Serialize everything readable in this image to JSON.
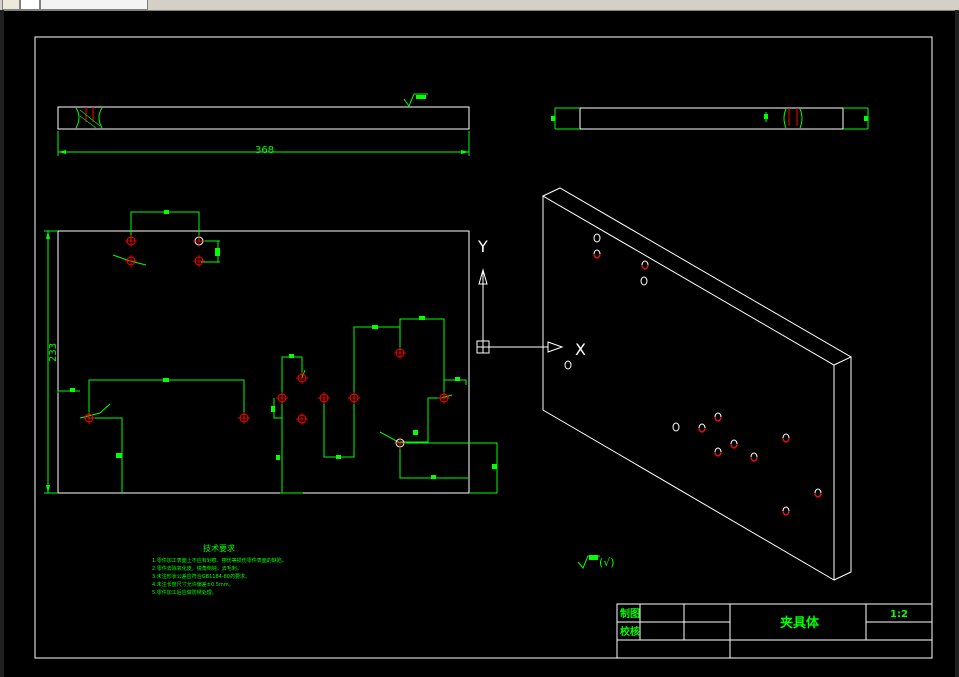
{
  "window": {
    "tabs": [
      "",
      "",
      ""
    ]
  },
  "drawing": {
    "dim_width": "368",
    "dim_height": "233",
    "axis_x": "X",
    "axis_y": "Y",
    "surface_finish_note": "(√)",
    "tech_requirements": {
      "title": "技术要求",
      "lines": [
        "1.零件加工表面上不应有划痕、擦伤等损伤零件表面的缺陷。",
        "2.零件去除氧化皮，锐角倒钝，去毛刺。",
        "3.未注形状公差应符合GB1184-80的要求。",
        "4.未注长度尺寸允许偏差±0.5mm。",
        "5.零件加工后应做防锈处理。"
      ]
    },
    "title_block": {
      "drawn_by": "制图",
      "checked_by": "校核",
      "part_name": "夹具体",
      "scale": "1:2"
    }
  },
  "colors": {
    "background": "#000000",
    "line": "#ffffff",
    "dimension": "#00ff00",
    "hole": "#ff0000"
  }
}
